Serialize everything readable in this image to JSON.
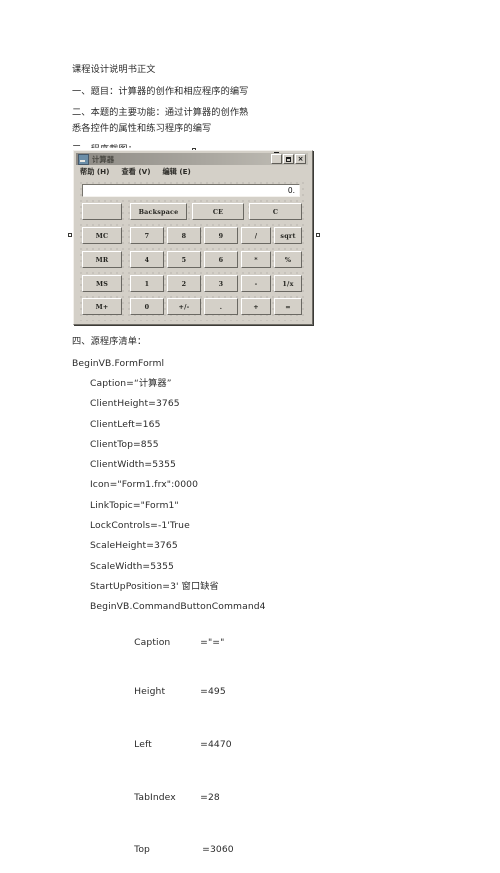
{
  "document": {
    "paragraphs": [
      "课程设计说明书正文",
      "一、题目：计算器的创作和相应程序的编写",
      "二、本题的主要功能：通过计算器的创作熟\n悉各控件的属性和练习程序的编写",
      "三、程序截图："
    ],
    "section_source_title": "四、源程序清单：",
    "code_lines": [
      "BeginVB.FormForml",
      "Caption=“计算器”",
      "ClientHeight=3765",
      "ClientLeft=165",
      "ClientTop=855",
      "ClientWidth=5355",
      "Icon=\"Form1.frx\":0000",
      "LinkTopic=\"Form1\"",
      "LockControls=-1'True",
      "ScaleHeight=3765",
      "ScaleWidth=5355",
      "StartUpPosition=3' 窗口缺省",
      "BeginVB.CommandButtonCommand4"
    ],
    "property_rows": [
      {
        "name": "Caption",
        "value": "=\"=\""
      },
      {
        "name": "Height",
        "value": "=495"
      },
      {
        "name": "Left",
        "value": "=4470"
      },
      {
        "name": "TabIndex",
        "value": "=28"
      },
      {
        "name": "Top",
        "value": "=3060"
      }
    ]
  },
  "calculator": {
    "title": "计算器",
    "title_icon": "calculator-app-icon",
    "window_buttons": [
      {
        "name": "minimize",
        "glyph": ""
      },
      {
        "name": "maximize",
        "glyph": ""
      },
      {
        "name": "close",
        "glyph": "×"
      }
    ],
    "menus": [
      "帮助 (H)",
      "查看 (V)",
      "编辑 (E)"
    ],
    "display_value": "0.",
    "top_row": [
      {
        "label": "",
        "name": "blank-button"
      },
      {
        "label": "Backspace",
        "name": "backspace-button"
      },
      {
        "label": "CE",
        "name": "clear-entry-button"
      },
      {
        "label": "C",
        "name": "clear-button"
      }
    ],
    "memory_keys": [
      {
        "label": "MC",
        "name": "memory-clear-button"
      },
      {
        "label": "MR",
        "name": "memory-recall-button"
      },
      {
        "label": "MS",
        "name": "memory-store-button"
      },
      {
        "label": "M+",
        "name": "memory-add-button"
      }
    ],
    "keypad_rows": [
      [
        {
          "label": "7",
          "name": "digit-7-button"
        },
        {
          "label": "8",
          "name": "digit-8-button"
        },
        {
          "label": "9",
          "name": "digit-9-button"
        },
        {
          "label": "/",
          "name": "divide-button"
        },
        {
          "label": "sqrt",
          "name": "sqrt-button"
        }
      ],
      [
        {
          "label": "4",
          "name": "digit-4-button"
        },
        {
          "label": "5",
          "name": "digit-5-button"
        },
        {
          "label": "6",
          "name": "digit-6-button"
        },
        {
          "label": "*",
          "name": "multiply-button"
        },
        {
          "label": "%",
          "name": "percent-button"
        }
      ],
      [
        {
          "label": "1",
          "name": "digit-1-button"
        },
        {
          "label": "2",
          "name": "digit-2-button"
        },
        {
          "label": "3",
          "name": "digit-3-button"
        },
        {
          "label": "-",
          "name": "subtract-button"
        },
        {
          "label": "1/x",
          "name": "reciprocal-button"
        }
      ],
      [
        {
          "label": "0",
          "name": "digit-0-button"
        },
        {
          "label": "+/-",
          "name": "sign-toggle-button"
        },
        {
          "label": ".",
          "name": "decimal-point-button"
        },
        {
          "label": "+",
          "name": "add-button"
        },
        {
          "label": "=",
          "name": "equals-button"
        }
      ]
    ]
  },
  "colors": {
    "page_background": "#ffffff",
    "window_face": "#d4d0c8",
    "titlebar_start": "#8e8b85",
    "titlebar_end": "#c3c0b8",
    "display_background": "#ffffff",
    "text": "#2b2b2b"
  }
}
